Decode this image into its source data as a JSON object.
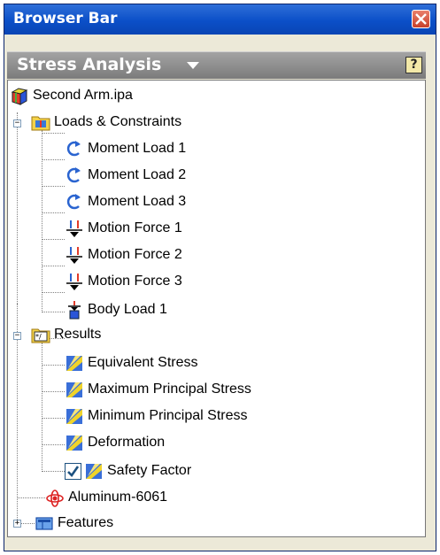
{
  "window": {
    "title": "Browser Bar"
  },
  "panel": {
    "title": "Stress Analysis",
    "help_glyph": "?"
  },
  "tree": {
    "root": {
      "label": "Second Arm.ipa",
      "icon": "assembly-icon"
    },
    "loads": {
      "label": "Loads & Constraints",
      "expander": "−",
      "items": [
        {
          "label": "Moment Load 1",
          "icon": "moment-load-icon"
        },
        {
          "label": "Moment Load 2",
          "icon": "moment-load-icon"
        },
        {
          "label": "Moment Load 3",
          "icon": "moment-load-icon"
        },
        {
          "label": "Motion Force 1",
          "icon": "motion-force-icon"
        },
        {
          "label": "Motion Force 2",
          "icon": "motion-force-icon"
        },
        {
          "label": "Motion Force 3",
          "icon": "motion-force-icon"
        },
        {
          "label": "Body Load 1",
          "icon": "body-load-icon"
        }
      ]
    },
    "results": {
      "label": "Results",
      "expander": "−",
      "items": [
        {
          "label": "Equivalent Stress",
          "icon": "result-icon"
        },
        {
          "label": "Maximum Principal Stress",
          "icon": "result-icon"
        },
        {
          "label": "Minimum Principal Stress",
          "icon": "result-icon"
        },
        {
          "label": "Deformation",
          "icon": "result-icon"
        },
        {
          "label": "Safety Factor",
          "icon": "result-icon",
          "checked": true
        }
      ]
    },
    "material": {
      "label": "Aluminum-6061",
      "icon": "material-icon"
    },
    "features": {
      "label": "Features",
      "expander": "+",
      "icon": "features-icon"
    }
  },
  "colors": {
    "title_bar": "#0b4fc8",
    "panel_header": "#8d8d8d",
    "close": "#d4533a"
  }
}
